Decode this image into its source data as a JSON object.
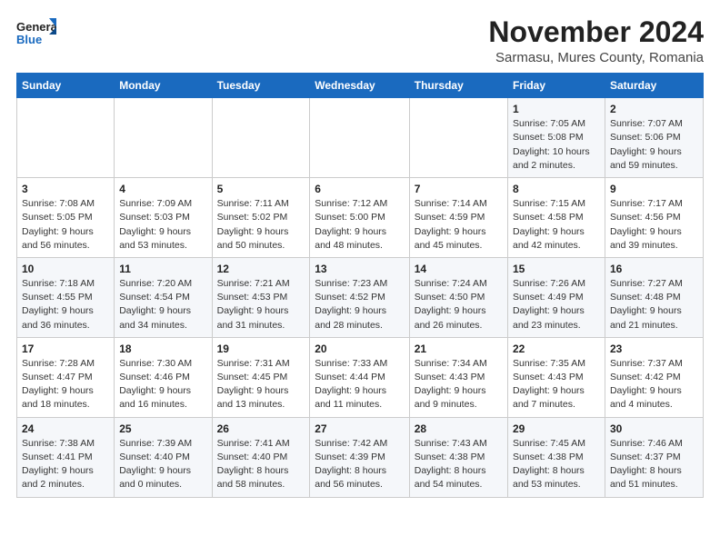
{
  "logo": {
    "line1": "General",
    "line2": "Blue"
  },
  "title": "November 2024",
  "subtitle": "Sarmasu, Mures County, Romania",
  "weekdays": [
    "Sunday",
    "Monday",
    "Tuesday",
    "Wednesday",
    "Thursday",
    "Friday",
    "Saturday"
  ],
  "weeks": [
    [
      {
        "day": "",
        "info": ""
      },
      {
        "day": "",
        "info": ""
      },
      {
        "day": "",
        "info": ""
      },
      {
        "day": "",
        "info": ""
      },
      {
        "day": "",
        "info": ""
      },
      {
        "day": "1",
        "info": "Sunrise: 7:05 AM\nSunset: 5:08 PM\nDaylight: 10 hours\nand 2 minutes."
      },
      {
        "day": "2",
        "info": "Sunrise: 7:07 AM\nSunset: 5:06 PM\nDaylight: 9 hours\nand 59 minutes."
      }
    ],
    [
      {
        "day": "3",
        "info": "Sunrise: 7:08 AM\nSunset: 5:05 PM\nDaylight: 9 hours\nand 56 minutes."
      },
      {
        "day": "4",
        "info": "Sunrise: 7:09 AM\nSunset: 5:03 PM\nDaylight: 9 hours\nand 53 minutes."
      },
      {
        "day": "5",
        "info": "Sunrise: 7:11 AM\nSunset: 5:02 PM\nDaylight: 9 hours\nand 50 minutes."
      },
      {
        "day": "6",
        "info": "Sunrise: 7:12 AM\nSunset: 5:00 PM\nDaylight: 9 hours\nand 48 minutes."
      },
      {
        "day": "7",
        "info": "Sunrise: 7:14 AM\nSunset: 4:59 PM\nDaylight: 9 hours\nand 45 minutes."
      },
      {
        "day": "8",
        "info": "Sunrise: 7:15 AM\nSunset: 4:58 PM\nDaylight: 9 hours\nand 42 minutes."
      },
      {
        "day": "9",
        "info": "Sunrise: 7:17 AM\nSunset: 4:56 PM\nDaylight: 9 hours\nand 39 minutes."
      }
    ],
    [
      {
        "day": "10",
        "info": "Sunrise: 7:18 AM\nSunset: 4:55 PM\nDaylight: 9 hours\nand 36 minutes."
      },
      {
        "day": "11",
        "info": "Sunrise: 7:20 AM\nSunset: 4:54 PM\nDaylight: 9 hours\nand 34 minutes."
      },
      {
        "day": "12",
        "info": "Sunrise: 7:21 AM\nSunset: 4:53 PM\nDaylight: 9 hours\nand 31 minutes."
      },
      {
        "day": "13",
        "info": "Sunrise: 7:23 AM\nSunset: 4:52 PM\nDaylight: 9 hours\nand 28 minutes."
      },
      {
        "day": "14",
        "info": "Sunrise: 7:24 AM\nSunset: 4:50 PM\nDaylight: 9 hours\nand 26 minutes."
      },
      {
        "day": "15",
        "info": "Sunrise: 7:26 AM\nSunset: 4:49 PM\nDaylight: 9 hours\nand 23 minutes."
      },
      {
        "day": "16",
        "info": "Sunrise: 7:27 AM\nSunset: 4:48 PM\nDaylight: 9 hours\nand 21 minutes."
      }
    ],
    [
      {
        "day": "17",
        "info": "Sunrise: 7:28 AM\nSunset: 4:47 PM\nDaylight: 9 hours\nand 18 minutes."
      },
      {
        "day": "18",
        "info": "Sunrise: 7:30 AM\nSunset: 4:46 PM\nDaylight: 9 hours\nand 16 minutes."
      },
      {
        "day": "19",
        "info": "Sunrise: 7:31 AM\nSunset: 4:45 PM\nDaylight: 9 hours\nand 13 minutes."
      },
      {
        "day": "20",
        "info": "Sunrise: 7:33 AM\nSunset: 4:44 PM\nDaylight: 9 hours\nand 11 minutes."
      },
      {
        "day": "21",
        "info": "Sunrise: 7:34 AM\nSunset: 4:43 PM\nDaylight: 9 hours\nand 9 minutes."
      },
      {
        "day": "22",
        "info": "Sunrise: 7:35 AM\nSunset: 4:43 PM\nDaylight: 9 hours\nand 7 minutes."
      },
      {
        "day": "23",
        "info": "Sunrise: 7:37 AM\nSunset: 4:42 PM\nDaylight: 9 hours\nand 4 minutes."
      }
    ],
    [
      {
        "day": "24",
        "info": "Sunrise: 7:38 AM\nSunset: 4:41 PM\nDaylight: 9 hours\nand 2 minutes."
      },
      {
        "day": "25",
        "info": "Sunrise: 7:39 AM\nSunset: 4:40 PM\nDaylight: 9 hours\nand 0 minutes."
      },
      {
        "day": "26",
        "info": "Sunrise: 7:41 AM\nSunset: 4:40 PM\nDaylight: 8 hours\nand 58 minutes."
      },
      {
        "day": "27",
        "info": "Sunrise: 7:42 AM\nSunset: 4:39 PM\nDaylight: 8 hours\nand 56 minutes."
      },
      {
        "day": "28",
        "info": "Sunrise: 7:43 AM\nSunset: 4:38 PM\nDaylight: 8 hours\nand 54 minutes."
      },
      {
        "day": "29",
        "info": "Sunrise: 7:45 AM\nSunset: 4:38 PM\nDaylight: 8 hours\nand 53 minutes."
      },
      {
        "day": "30",
        "info": "Sunrise: 7:46 AM\nSunset: 4:37 PM\nDaylight: 8 hours\nand 51 minutes."
      }
    ]
  ]
}
